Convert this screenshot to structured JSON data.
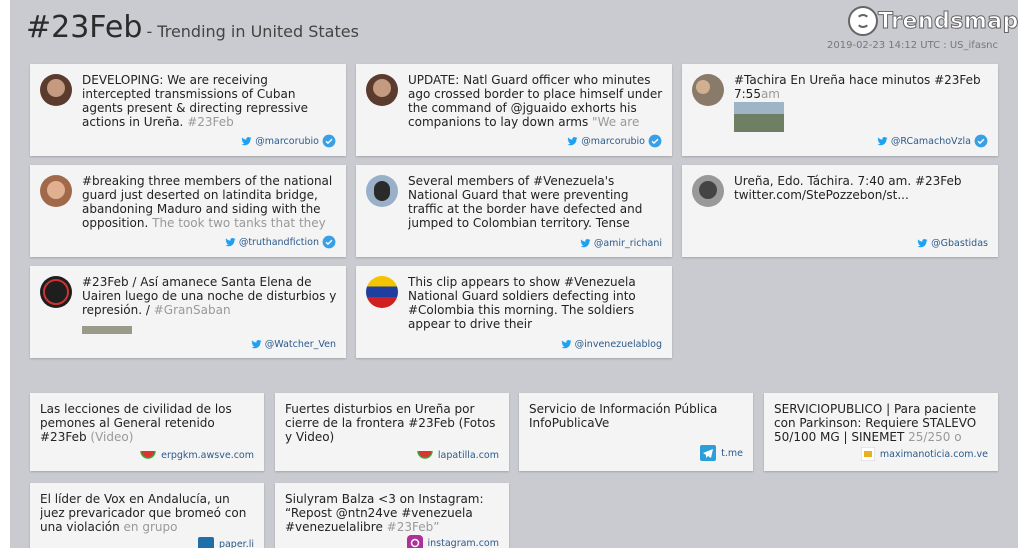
{
  "header": {
    "hashtag": "#23Feb",
    "subtitle": "- Trending in United States",
    "brand": "Trendsmap",
    "timestamp": "2019-02-23 14:12 UTC : US_ifasnc"
  },
  "colors": {
    "background": "#c9cbd1",
    "card": "#f4f4f5",
    "verified": "#3aa0e6",
    "twitter": "#1da1f2",
    "link": "#2b5a8a"
  },
  "tweets": [
    {
      "text": "DEVELOPING: We are receiving intercepted transmissions of Cuban agents present & directing repressive actions in Ureña. ",
      "fade": "#23Feb",
      "handle": "@marcorubio",
      "verified": true,
      "avatar_color": "#5a3b2e"
    },
    {
      "text": "UPDATE: Natl Guard officer who minutes ago crossed border to place himself under the command of @jguaido exhorts his companions to lay down arms ",
      "fade": "\"We are",
      "handle": "@marcorubio",
      "verified": true,
      "avatar_color": "#5a3b2e"
    },
    {
      "text": "#Tachira En Ureña hace minutos #23Feb 7:55",
      "fade": "am",
      "handle": "@RCamachoVzla",
      "verified": true,
      "avatar_color": "#7a6a5a"
    },
    {
      "text": "#breaking three members of the national guard just deserted on latindita bridge, abandoning Maduro and siding with the opposition. ",
      "fade": "The took two tanks that they",
      "handle": "@truthandfiction",
      "verified": true,
      "avatar_color": "#b07a5a"
    },
    {
      "text": "Several members of #Venezuela's National Guard that were preventing traffic at the border have defected and jumped to Colombian territory. Tense",
      "fade": "",
      "handle": "@amir_richani",
      "verified": false,
      "avatar_color": "#3b3b3b"
    },
    {
      "text": "Ureña, Edo. Táchira. 7:40 am. #23Feb twitter.com/StePozzebon/st...",
      "fade": "",
      "handle": "@Gbastidas",
      "verified": false,
      "avatar_color": "#777777"
    },
    {
      "text": "#23Feb / Así amanece Santa Elena de Uairen luego de una noche de disturbios y represión. / ",
      "fade": "#GranSaban",
      "handle": "@Watcher_Ven",
      "verified": false,
      "avatar_color": "#1e1e1e"
    },
    {
      "text": "This clip appears to show #Venezuela National Guard soldiers defecting into #Colombia this morning. The soldiers appear to drive their",
      "fade": "",
      "handle": "@invenezuelablog",
      "verified": false,
      "avatar_color": "#f2c500"
    }
  ],
  "links": [
    {
      "text": "Las lecciones de civilidad de los pemones al General retenido #23Feb ",
      "fade": "(Video)",
      "domain": "erpgkm.awsve.com",
      "icon": "watermelon-icon"
    },
    {
      "text": "Fuertes disturbios en Ureña por cierre de la frontera #23Feb (Fotos y Video)",
      "fade": "",
      "domain": "lapatilla.com",
      "icon": "watermelon-icon"
    },
    {
      "text": "Servicio de Información Pública InfoPublicaVe",
      "fade": "",
      "domain": "t.me",
      "icon": "telegram-icon"
    },
    {
      "text": "SERVICIOPUBLICO | Para paciente con Parkinson: Requiere STALEVO 50/100 MG | SINEMET ",
      "fade": "25/250 o",
      "domain": "maximanoticia.com.ve",
      "icon": "news-icon"
    },
    {
      "text": "El líder de Vox en Andalucía, un juez prevaricador que bromeó con una violación ",
      "fade": "en grupo",
      "domain": "paper.li",
      "icon": "paperli-icon"
    },
    {
      "text": "Siulyram Balza <3 on Instagram: “Repost @ntn24ve #venezuela #venezuelalibre ",
      "fade": "#23Feb”",
      "domain": "instagram.com",
      "icon": "instagram-icon"
    }
  ]
}
